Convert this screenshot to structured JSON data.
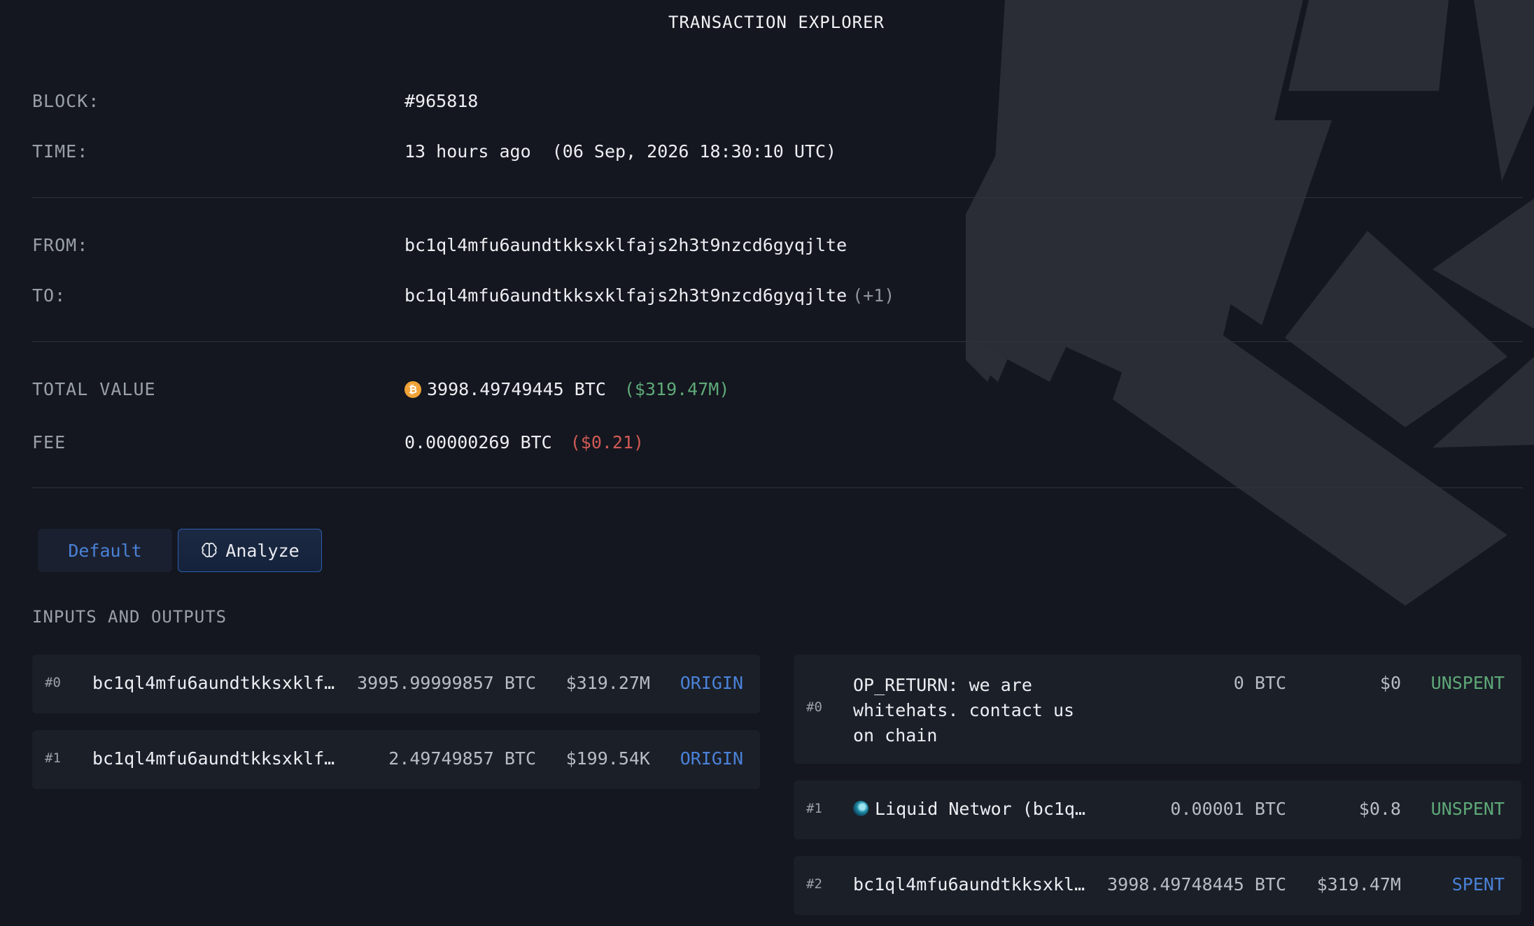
{
  "title": "TRANSACTION EXPLORER",
  "fields": {
    "block_label": "BLOCK:",
    "block_value": "#965818",
    "time_label": "TIME:",
    "time_value": "13 hours ago  (06 Sep, 2026 18:30:10 UTC)",
    "from_label": "FROM:",
    "from_value": "bc1ql4mfu6aundtkksxklfajs2h3t9nzcd6gyqjlte",
    "to_label": "TO:",
    "to_value": "bc1ql4mfu6aundtkksxklfajs2h3t9nzcd6gyqjlte",
    "to_extra": "(+1)",
    "total_label": "TOTAL VALUE",
    "total_btc": "3998.49749445 BTC",
    "total_usd": "($319.47M)",
    "fee_label": "FEE",
    "fee_btc": "0.00000269 BTC",
    "fee_usd": "($0.21)"
  },
  "tabs": {
    "default_label": "Default",
    "analyze_label": "Analyze"
  },
  "section_title": "INPUTS AND OUTPUTS",
  "inputs": [
    {
      "index": "#0",
      "address": "bc1ql4mfu6aundtkksxklf…",
      "amount": "3995.99999857 BTC",
      "usd": "$319.27M",
      "status": "ORIGIN"
    },
    {
      "index": "#1",
      "address": "bc1ql4mfu6aundtkksxklf…",
      "amount": "2.49749857 BTC",
      "usd": "$199.54K",
      "status": "ORIGIN"
    }
  ],
  "outputs": [
    {
      "index": "#0",
      "address_line1": "OP_RETURN: we are",
      "address_line2": "whitehats. contact us",
      "address_line3": "on chain",
      "amount": "0 BTC",
      "usd": "$0",
      "status": "UNSPENT"
    },
    {
      "index": "#1",
      "address": "Liquid Networ (bc1q…",
      "amount": "0.00001 BTC",
      "usd": "$0.8",
      "status": "UNSPENT"
    },
    {
      "index": "#2",
      "address": "bc1ql4mfu6aundtkksxkl…",
      "amount": "3998.49748445 BTC",
      "usd": "$319.47M",
      "status": "SPENT"
    }
  ],
  "colors": {
    "background": "#14171f",
    "card": "#1b1f28",
    "accent_blue": "#4a82d8",
    "green": "#5ea978",
    "red": "#d05a55",
    "btc_orange": "#f0a338"
  },
  "icons": {
    "btc": "bitcoin-icon",
    "analyze": "brain-icon",
    "liquid": "liquid-network-icon",
    "background": "watermark-logo"
  }
}
